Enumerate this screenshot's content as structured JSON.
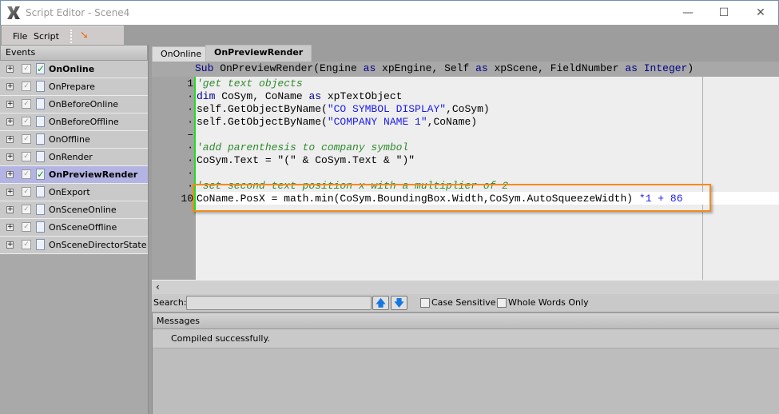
{
  "window": {
    "title": "Script Editor - Scene4",
    "minimize": "—",
    "maximize": "☐",
    "close": "✕"
  },
  "menu": {
    "file": "File",
    "script": "Script",
    "run_icon": "wand-icon"
  },
  "events": {
    "header": "Events",
    "items": [
      {
        "label": "OnOnline",
        "checked": true,
        "has_script": true,
        "bold": true
      },
      {
        "label": "OnPrepare"
      },
      {
        "label": "OnBeforeOnline"
      },
      {
        "label": "OnBeforeOffline"
      },
      {
        "label": "OnOffline"
      },
      {
        "label": "OnRender"
      },
      {
        "label": "OnPreviewRender",
        "has_script": true,
        "bold": true,
        "selected": true
      },
      {
        "label": "OnExport"
      },
      {
        "label": "OnSceneOnline"
      },
      {
        "label": "OnSceneOffline"
      },
      {
        "label": "OnSceneDirectorState"
      }
    ]
  },
  "tabs": [
    {
      "label": "OnOnline"
    },
    {
      "label": "OnPreviewRender",
      "active": true
    }
  ],
  "editor": {
    "header": [
      [
        "k",
        "Sub"
      ],
      [
        "t",
        " OnPreviewRender(Engine "
      ],
      [
        "k",
        "as"
      ],
      [
        "t",
        " xpEngine, Self "
      ],
      [
        "k",
        "as"
      ],
      [
        "t",
        " xpScene, FieldNumber "
      ],
      [
        "k",
        "as"
      ],
      [
        "k",
        " Integer"
      ],
      [
        "t",
        ")"
      ]
    ],
    "line_numbers": [
      "1",
      "·",
      "·",
      "·",
      "–",
      "·",
      "·",
      "·",
      "·",
      "10"
    ],
    "lines": [
      [
        [
          "c",
          "'get text objects"
        ]
      ],
      [
        [
          "k",
          "dim"
        ],
        [
          "t",
          " CoSym, CoName "
        ],
        [
          "k",
          "as"
        ],
        [
          "t",
          " xpTextObject"
        ]
      ],
      [
        [
          "t",
          "self.GetObjectByName("
        ],
        [
          "s",
          "\"CO SYMBOL DISPLAY\""
        ],
        [
          "t",
          ",CoSym)"
        ]
      ],
      [
        [
          "t",
          "self.GetObjectByName("
        ],
        [
          "s",
          "\"COMPANY NAME 1\""
        ],
        [
          "t",
          ",CoName)"
        ]
      ],
      [],
      [
        [
          "c",
          "'add parenthesis to company symbol"
        ]
      ],
      [
        [
          "t",
          "CoSym.Text = \"(\" & CoSym.Text & \")\""
        ]
      ],
      [],
      [
        [
          "c",
          "'set second text position x with a multiplier of 2"
        ]
      ],
      [
        [
          "t",
          "CoName.PosX = math.min(CoSym.BoundingBox.Width,CoSym.AutoSqueezeWidth) "
        ],
        [
          "n",
          "*1 + 86"
        ]
      ]
    ],
    "colors": {
      "k": "#00008b",
      "t": "#000000",
      "c": "#2e8b2e",
      "s": "#1a1aee",
      "n": "#1a1aee"
    },
    "current_line": 10
  },
  "search": {
    "label": "Search:",
    "value": "",
    "up": "🡅",
    "down": "🡇",
    "case_sensitive": "Case Sensitive",
    "whole_words": "Whole Words Only"
  },
  "messages": {
    "header": "Messages",
    "text": "Compiled successfully."
  }
}
